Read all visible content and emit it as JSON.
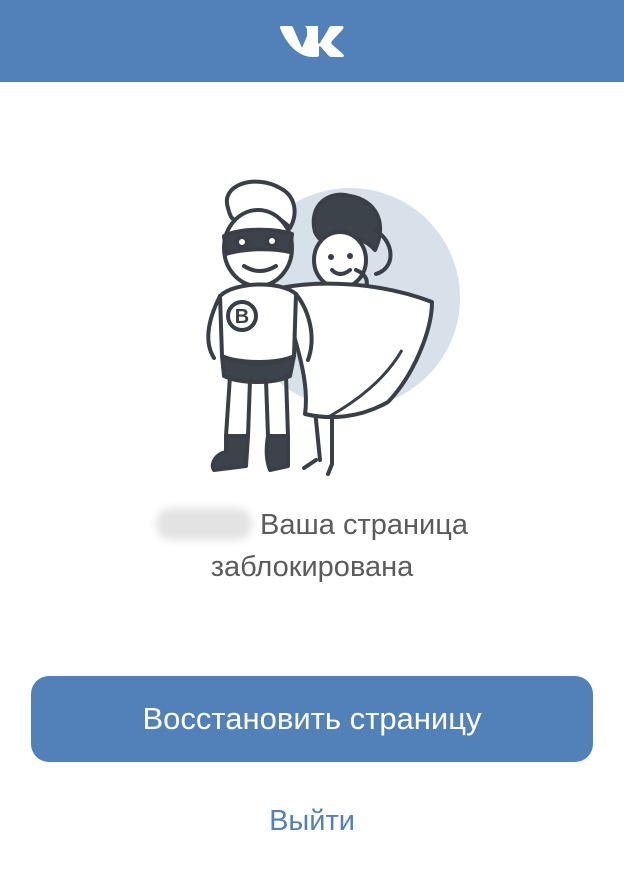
{
  "header": {
    "logo_icon": "vk-logo-icon",
    "brand_color": "#5181b8"
  },
  "illustration": {
    "icon": "superhero-couple-illustration",
    "badge_letter": "В"
  },
  "message": {
    "line1": "Ваша страница",
    "line2": "заблокирована"
  },
  "actions": {
    "restore_label": "Восстановить страницу",
    "logout_label": "Выйти"
  }
}
